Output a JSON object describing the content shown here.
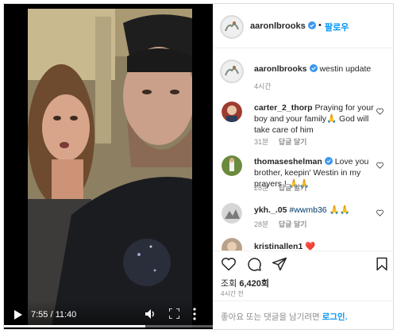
{
  "video": {
    "time_display": "7:55 / 11:40",
    "progress_fraction": 0.678
  },
  "header": {
    "username": "aaronlbrooks",
    "separator": "•",
    "follow_label": "팔로우"
  },
  "caption": {
    "username": "aaronlbrooks",
    "text": "westin update",
    "time": "4시간"
  },
  "comments": [
    {
      "username": "carter_2_thorp",
      "text": "Praying for your boy and your family🙏 God will take care of him",
      "time": "31분",
      "reply_label": "답글 달기",
      "verified": false
    },
    {
      "username": "thomaseshelman",
      "text": "Love you brother, keepin' Westin in my prayers ! 🙏🙏",
      "time": "28분",
      "reply_label": "답글 달기",
      "verified": true
    },
    {
      "username": "ykh._.05",
      "text": "#wwmb36 🙏🙏",
      "time": "28분",
      "reply_label": "답글 달기",
      "verified": false
    },
    {
      "username": "kristinallen1",
      "text": "❤️",
      "time": "",
      "reply_label": "",
      "verified": false
    }
  ],
  "stats": {
    "views_label": "조회",
    "views_count": "6,420회",
    "time_ago": "4시간 전"
  },
  "add_comment": {
    "prompt": "좋아요 또는 댓글을 남기려면",
    "login_label": "로그인."
  },
  "colors": {
    "link_blue": "#0095f6",
    "text_dark": "#262626",
    "text_gray": "#8e8e8e",
    "border": "#dbdbdb",
    "verified_blue": "#3897f0"
  },
  "icons": [
    "play-icon",
    "volume-icon",
    "fullscreen-icon",
    "more-options-icon",
    "verified-icon",
    "heart-icon",
    "comment-icon",
    "share-icon",
    "bookmark-icon"
  ]
}
